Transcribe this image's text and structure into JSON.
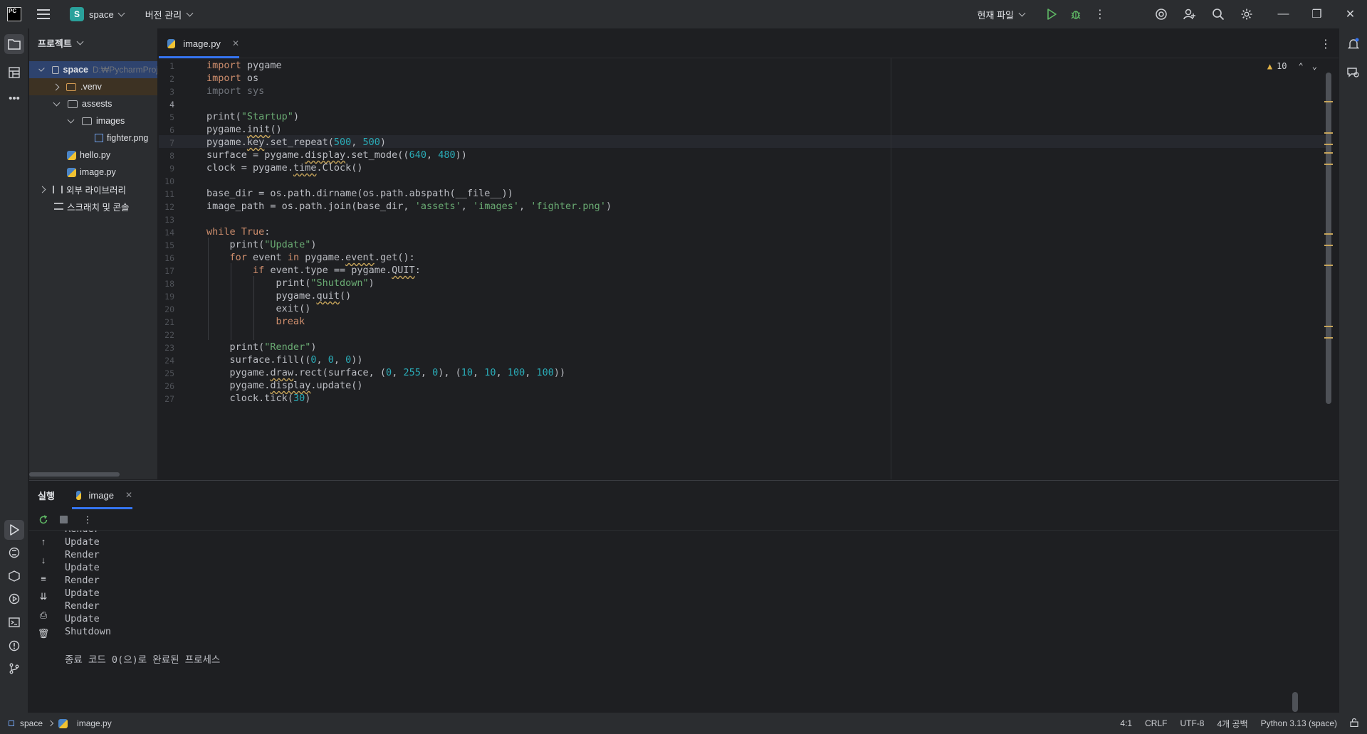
{
  "titlebar": {
    "app_logo": "PC",
    "project_badge": "S",
    "project_name": "space",
    "vcs_label": "버전 관리",
    "run_config": "현재 파일"
  },
  "project_panel": {
    "title": "프로젝트",
    "tree": [
      {
        "label": "space",
        "hint": "D:₩PycharmProj",
        "type": "folder",
        "expanded": true,
        "depth": 0
      },
      {
        "label": ".venv",
        "type": "folder",
        "expanded": false,
        "depth": 1
      },
      {
        "label": "assests",
        "type": "folder",
        "expanded": true,
        "depth": 1
      },
      {
        "label": "images",
        "type": "folder",
        "expanded": true,
        "depth": 2
      },
      {
        "label": "fighter.png",
        "type": "image",
        "depth": 3
      },
      {
        "label": "hello.py",
        "type": "python",
        "depth": 1
      },
      {
        "label": "image.py",
        "type": "python",
        "depth": 1
      },
      {
        "label": "외부 라이브러리",
        "type": "library",
        "depth": 0
      },
      {
        "label": "스크래치 및 콘솔",
        "type": "scratch",
        "depth": 0
      }
    ]
  },
  "editor": {
    "tab_label": "image.py",
    "inspection_count": "10",
    "line_numbers": [
      "1",
      "2",
      "3",
      "4",
      "5",
      "6",
      "7",
      "8",
      "9",
      "10",
      "11",
      "12",
      "13",
      "14",
      "15",
      "16",
      "17",
      "18",
      "19",
      "20",
      "21",
      "22",
      "23",
      "24",
      "25",
      "26",
      "27"
    ],
    "code_lines": [
      "import pygame",
      "import os",
      "import sys",
      "",
      "print(\"Startup\")",
      "pygame.init()",
      "pygame.key.set_repeat(500, 500)",
      "surface = pygame.display.set_mode((640, 480))",
      "clock = pygame.time.Clock()",
      "",
      "base_dir = os.path.dirname(os.path.abspath(__file__))",
      "image_path = os.path.join(base_dir, 'assets', 'images', 'fighter.png')",
      "",
      "while True:",
      "    print(\"Update\")",
      "    for event in pygame.event.get():",
      "        if event.type == pygame.QUIT:",
      "            print(\"Shutdown\")",
      "            pygame.quit()",
      "            exit()",
      "            break",
      "",
      "    print(\"Render\")",
      "    surface.fill((0, 0, 0))",
      "    pygame.draw.rect(surface, (0, 255, 0), (10, 10, 100, 100))",
      "    pygame.display.update()",
      "    clock.tick(30)"
    ]
  },
  "run_panel": {
    "title": "실행",
    "tab_label": "image",
    "console_lines": [
      "Render",
      "Update",
      "Render",
      "Update",
      "Render",
      "Update",
      "Render",
      "Update",
      "Shutdown",
      "",
      "종료 코드 0(으)로 완료된 프로세스"
    ]
  },
  "statusbar": {
    "project": "space",
    "file": "image.py",
    "position": "4:1",
    "line_sep": "CRLF",
    "encoding": "UTF-8",
    "indent": "4개 공백",
    "interpreter": "Python 3.13 (space)"
  },
  "colors": {
    "accent": "#3574f0",
    "keyword": "#cf8e6d",
    "string": "#6aab73",
    "number": "#2aacb8",
    "warning": "#c7a55b"
  }
}
